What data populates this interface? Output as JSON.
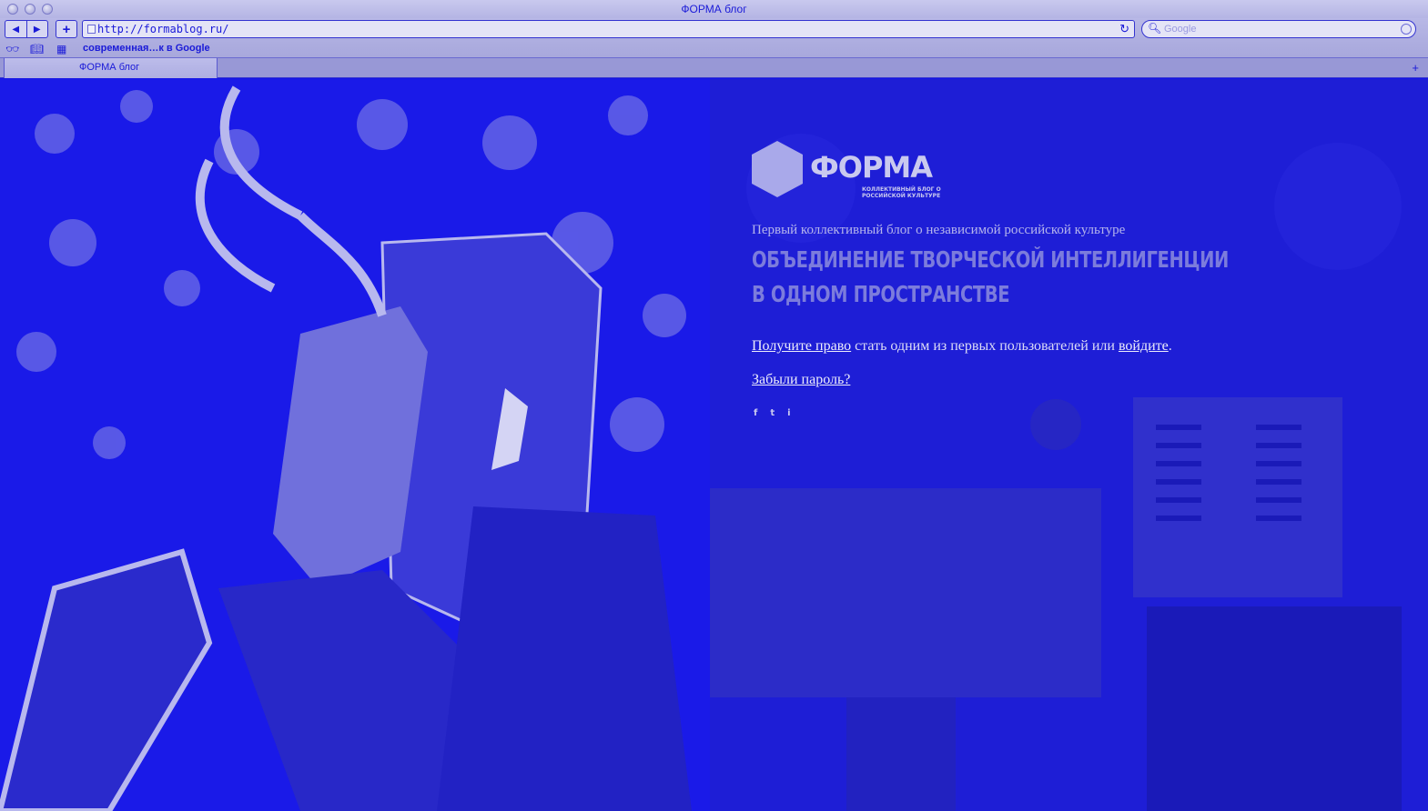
{
  "window": {
    "title": "ФОРМА блог"
  },
  "toolbar": {
    "back_icon": "◀",
    "forward_icon": "▶",
    "add_icon": "+",
    "url": "http://formablog.ru/",
    "reload_icon": "↻",
    "search_placeholder": "Google",
    "search_icon": "🔍︎"
  },
  "bookmarks": {
    "reading_icon": "👓︎",
    "book_icon": "📖︎",
    "grid_icon": "▦",
    "link_label": "современная…к в Google"
  },
  "tabs": [
    {
      "label": "ФОРМА блог"
    }
  ],
  "newtab_icon": "+",
  "site": {
    "logo_text": "ФОРМА",
    "logo_sub": "Коллективный блог о российской культуре",
    "tagline": "Первый коллективный блог о независимой российской культуре",
    "headline_line1": "ОБЪЕДИНЕНИЕ ТВОРЧЕСКОЙ ИНТЕЛЛИГЕНЦИИ",
    "headline_line2": "В ОДНОМ ПРОСТРАНСТВЕ",
    "invite_link1": "Получите право",
    "invite_middle": " стать одним из первых пользователей или ",
    "invite_link2": "войдите",
    "invite_end": ".",
    "forgot_password": "Забыли пароль?",
    "social": [
      "f",
      "t",
      "i"
    ]
  },
  "colors": {
    "page_blue": "#1414e6",
    "text_light": "#dcdcf6",
    "headline": "#7c7cdc"
  }
}
